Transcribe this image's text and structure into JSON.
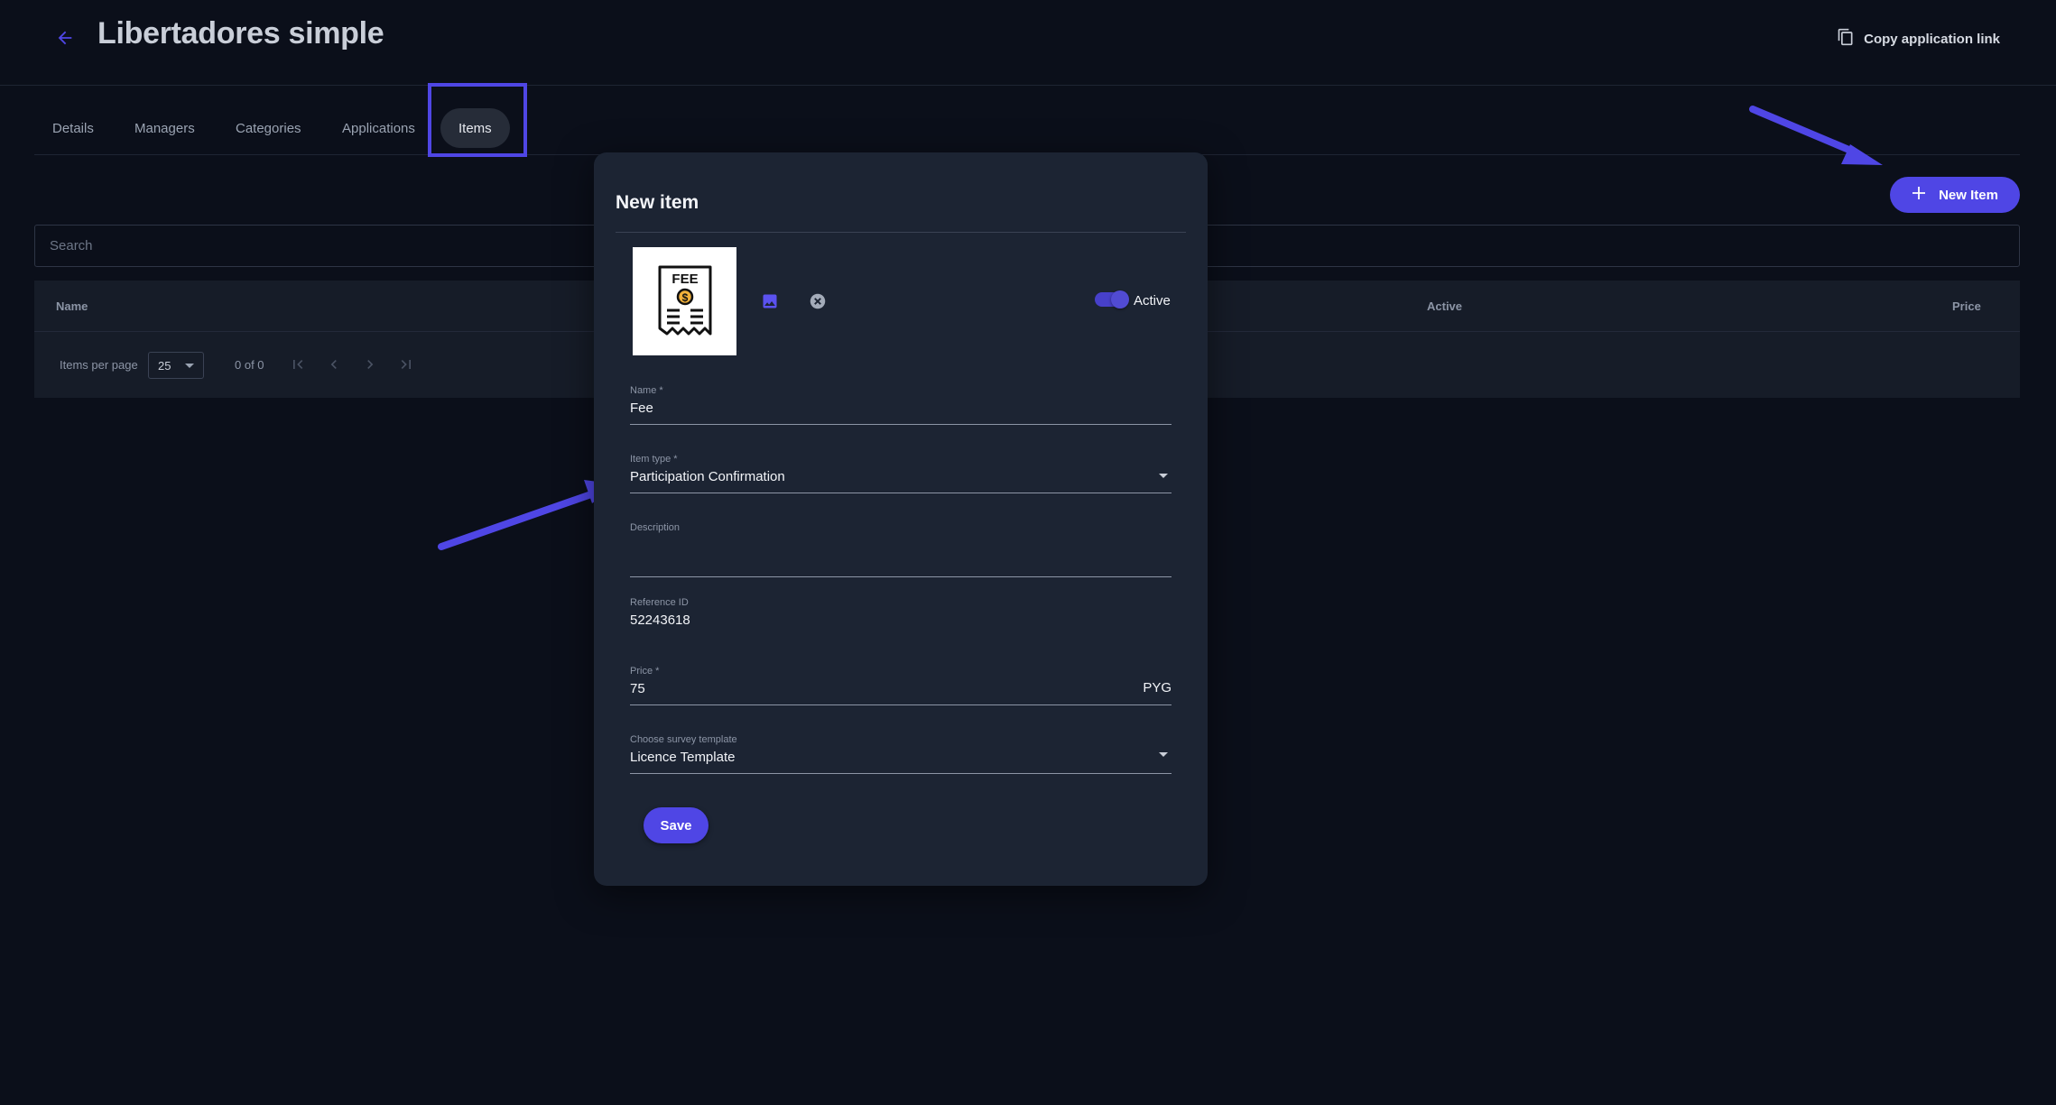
{
  "header": {
    "title": "Libertadores simple",
    "copy_link_label": "Copy application link"
  },
  "tabs": [
    {
      "label": "Details"
    },
    {
      "label": "Managers"
    },
    {
      "label": "Categories"
    },
    {
      "label": "Applications"
    },
    {
      "label": "Items",
      "active": true
    }
  ],
  "toolbar": {
    "new_item_label": "New Item"
  },
  "search": {
    "placeholder": "Search"
  },
  "table": {
    "columns": [
      "Name",
      "Active",
      "Price"
    ],
    "footer": {
      "items_per_page_label": "Items per page",
      "items_per_page_value": "25",
      "range_text": "0 of 0"
    }
  },
  "dialog": {
    "title": "New item",
    "image_alt": "FEE",
    "active_label": "Active",
    "active_on": true,
    "fields": {
      "name": {
        "label": "Name *",
        "value": "Fee"
      },
      "item_type": {
        "label": "Item type *",
        "value": "Participation Confirmation"
      },
      "description": {
        "label": "Description",
        "value": ""
      },
      "reference_id": {
        "label": "Reference ID",
        "value": "52243618"
      },
      "price": {
        "label": "Price *",
        "value": "75",
        "currency": "PYG"
      },
      "survey_template": {
        "label": "Choose survey template",
        "value": "Licence Template"
      }
    },
    "save_label": "Save"
  },
  "colors": {
    "background": "#0b0f1a",
    "dialog": "#1c2433",
    "accent": "#4f46e5",
    "annotation": "#4f46e5"
  },
  "icons": [
    "back-arrow-icon",
    "copy-icon",
    "plus-icon",
    "first-page-icon",
    "prev-page-icon",
    "next-page-icon",
    "last-page-icon",
    "image-icon",
    "remove-icon",
    "fee-receipt-icon",
    "dropdown-icon"
  ]
}
